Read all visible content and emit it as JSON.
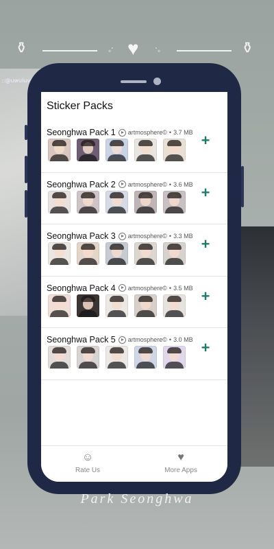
{
  "screen": {
    "title": "Sticker Packs"
  },
  "overlay": {
    "handle": "::@uwuluvu",
    "caption": "Park Seonghwa"
  },
  "packs": [
    {
      "name": "Seonghwa Pack 1",
      "author": "artmosphere©",
      "size": "3.7 MB",
      "thumb_colors": [
        "#d9c7bd",
        "#6f5e73",
        "#c9d3e6",
        "#e8e4de",
        "#e9dfd2"
      ]
    },
    {
      "name": "Seonghwa Pack 2",
      "author": "artmosphere©",
      "size": "3.6 MB",
      "thumb_colors": [
        "#e7e2df",
        "#cfc3c7",
        "#d6d9e6",
        "#bfb4b6",
        "#c8c0c2"
      ]
    },
    {
      "name": "Seonghwa Pack 3",
      "author": "artmosphere©",
      "size": "3.3 MB",
      "thumb_colors": [
        "#ebe6e2",
        "#e5d4c8",
        "#c6cad2",
        "#dcd6d0",
        "#d7d2ce"
      ]
    },
    {
      "name": "Seonghwa Pack 4",
      "author": "artmosphere©",
      "size": "3.5 MB",
      "thumb_colors": [
        "#f0ddd5",
        "#3b3533",
        "#ece8e4",
        "#d8cfc8",
        "#e6e2de"
      ]
    },
    {
      "name": "Seonghwa Pack 5",
      "author": "artmosphere©",
      "size": "3.0 MB",
      "thumb_colors": [
        "#e2ddd9",
        "#d9d4d4",
        "#ebe8e6",
        "#cfd7e6",
        "#e0d7ec"
      ]
    }
  ],
  "add_symbol": "+",
  "nav": [
    {
      "label": "Rate Us",
      "icon": "smiley-icon",
      "glyph": "☺"
    },
    {
      "label": "More Apps",
      "icon": "heart-icon",
      "glyph": "♥"
    }
  ],
  "colors": {
    "phone_frame": "#1f2844",
    "accent": "#1b7e6d"
  }
}
